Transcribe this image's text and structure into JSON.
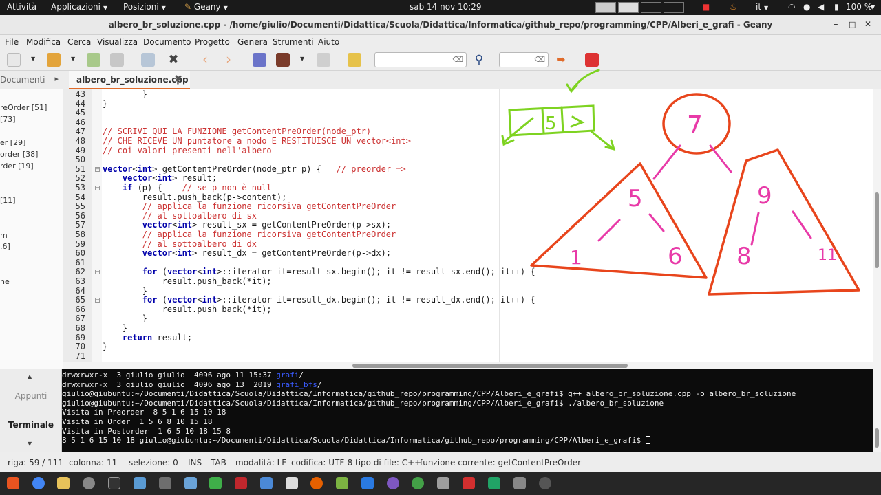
{
  "top_bar": {
    "activities": "Attività",
    "applications": "Applicazioni",
    "places": "Posizioni",
    "app": "Geany",
    "clock": "sab 14 nov 10:29",
    "lang": "it",
    "battery": "100 %"
  },
  "window": {
    "title": "albero_br_soluzione.cpp - /home/giulio/Documenti/Didattica/Scuola/Didattica/Informatica/github_repo/programming/CPP/Alberi_e_grafi - Geany",
    "minimize": "–",
    "maximize": "□",
    "close": "✕"
  },
  "menu": [
    "File",
    "Modifica",
    "Cerca",
    "Visualizza",
    "Documento",
    "Progetto",
    "Genera",
    "Strumenti",
    "Aiuto"
  ],
  "sidebar": {
    "tab_label": "Documenti",
    "symbols": [
      "reOrder [51]",
      "[73]",
      "er [29]",
      "order [38]",
      "rder [19]",
      "[11]",
      "m",
      ".6]",
      "ne"
    ]
  },
  "editor_tab": {
    "name": "albero_br_soluzione.cpp",
    "close": "✖"
  },
  "editor": {
    "lines": [
      {
        "n": "43",
        "t": "        }"
      },
      {
        "n": "44",
        "t": "}"
      },
      {
        "n": "45",
        "t": ""
      },
      {
        "n": "46",
        "t": ""
      },
      {
        "n": "47",
        "t": "// SCRIVI QUI LA FUNZIONE getContentPreOrder(node_ptr)"
      },
      {
        "n": "48",
        "t": "// CHE RICEVE UN puntatore a nodo E RESTITUISCE UN vector<int>"
      },
      {
        "n": "49",
        "t": "// coi valori presenti nell'albero"
      },
      {
        "n": "50",
        "t": ""
      },
      {
        "n": "51",
        "t": "vector<int> getContentPreOrder(node_ptr p) {   // preorder =>"
      },
      {
        "n": "52",
        "t": "    vector<int> result;"
      },
      {
        "n": "53",
        "t": "    if (p) {    // se p non è null"
      },
      {
        "n": "54",
        "t": "        result.push_back(p->content);"
      },
      {
        "n": "55",
        "t": "        // applica la funzione ricorsiva getContentPreOrder"
      },
      {
        "n": "56",
        "t": "        // al sottoalbero di sx"
      },
      {
        "n": "57",
        "t": "        vector<int> result_sx = getContentPreOrder(p->sx);"
      },
      {
        "n": "58",
        "t": "        // applica la funzione ricorsiva getContentPreOrder"
      },
      {
        "n": "59",
        "t": "        // al sottoalbero di dx"
      },
      {
        "n": "60",
        "t": "        vector<int> result_dx = getContentPreOrder(p->dx);"
      },
      {
        "n": "61",
        "t": ""
      },
      {
        "n": "62",
        "t": "        for (vector<int>::iterator it=result_sx.begin(); it != result_sx.end(); it++) {"
      },
      {
        "n": "63",
        "t": "            result.push_back(*it);"
      },
      {
        "n": "64",
        "t": "        }"
      },
      {
        "n": "65",
        "t": "        for (vector<int>::iterator it=result_dx.begin(); it != result_dx.end(); it++) {"
      },
      {
        "n": "66",
        "t": "            result.push_back(*it);"
      },
      {
        "n": "67",
        "t": "        }"
      },
      {
        "n": "68",
        "t": "    }"
      },
      {
        "n": "69",
        "t": "    return result;"
      },
      {
        "n": "70",
        "t": "}"
      },
      {
        "n": "71",
        "t": ""
      }
    ]
  },
  "drawing": {
    "node_value": "5",
    "root": "7",
    "left_child": "5",
    "left_left": "1",
    "left_right": "6",
    "right_child": "9",
    "right_left": "8",
    "right_right": "11",
    "colors": {
      "annotation": "#7ed321",
      "triangle": "#e8451c",
      "tree": "#e83aa8"
    }
  },
  "bottom_tabs": {
    "notes": "Appunti",
    "terminal": "Terminale"
  },
  "terminal": {
    "lines": [
      {
        "text": "drwxrwxr-x  3 giulio giulio  4096 ago 11 15:37 ",
        "dir": "grafi",
        "rest": "/"
      },
      {
        "text": "drwxrwxr-x  3 giulio giulio  4096 ago 13  2019 ",
        "dir": "grafi_bfs",
        "rest": "/"
      },
      {
        "text": "giulio@giubuntu:~/Documenti/Didattica/Scuola/Didattica/Informatica/github_repo/programming/CPP/Alberi_e_grafi$ g++ albero_br_soluzione.cpp -o albero_br_soluzione",
        "dir": "",
        "rest": ""
      },
      {
        "text": "giulio@giubuntu:~/Documenti/Didattica/Scuola/Didattica/Informatica/github_repo/programming/CPP/Alberi_e_grafi$ ./albero_br_soluzione",
        "dir": "",
        "rest": ""
      },
      {
        "text": "Visita in Preorder  8 5 1 6 15 10 18",
        "dir": "",
        "rest": ""
      },
      {
        "text": "Visita in Order  1 5 6 8 10 15 18",
        "dir": "",
        "rest": ""
      },
      {
        "text": "Visita in Postorder  1 6 5 10 18 15 8",
        "dir": "",
        "rest": ""
      },
      {
        "text": "8 5 1 6 15 10 18 giulio@giubuntu:~/Documenti/Didattica/Scuola/Didattica/Informatica/github_repo/programming/CPP/Alberi_e_grafi$ ",
        "dir": "",
        "rest": ""
      }
    ]
  },
  "status": {
    "line": "riga: 59 / 111",
    "column": "colonna: 11",
    "selection": "selezione: 0",
    "ins": "INS",
    "tab": "TAB",
    "mode": "modalità: LF",
    "encoding": "codifica: UTF-8",
    "filetype": "tipo di file: C++",
    "function": "funzione corrente: getContentPreOrder"
  }
}
